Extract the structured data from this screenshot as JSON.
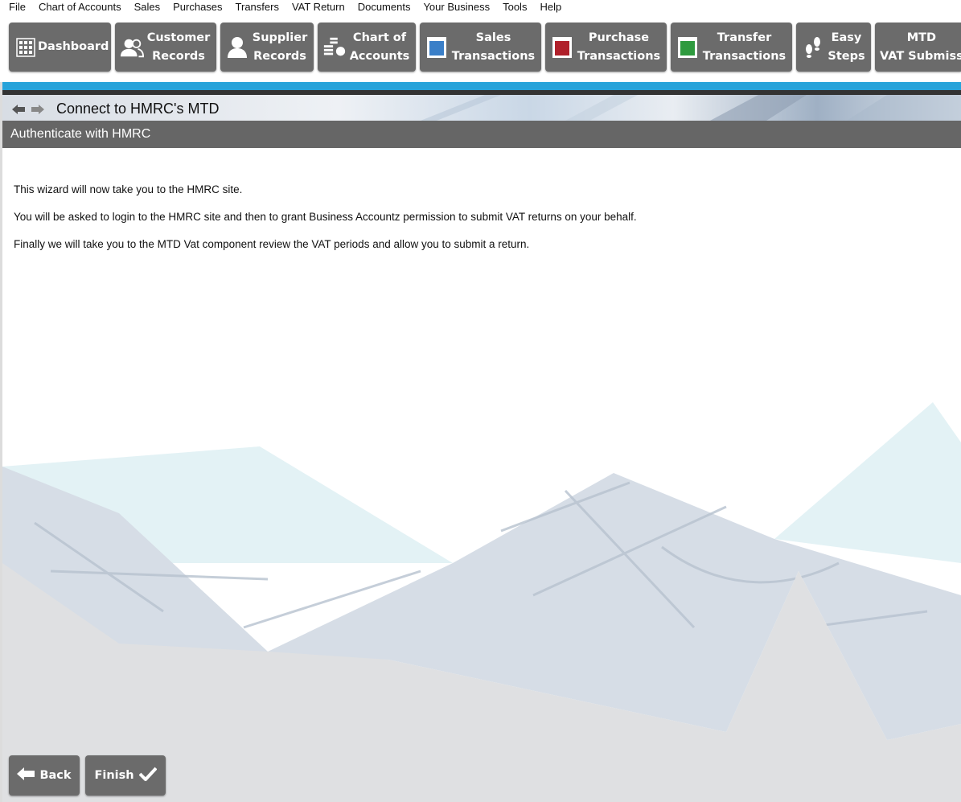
{
  "menu": [
    "File",
    "Chart of Accounts",
    "Sales",
    "Purchases",
    "Transfers",
    "VAT Return",
    "Documents",
    "Your Business",
    "Tools",
    "Help"
  ],
  "toolbar": {
    "dashboard": {
      "label": "Dashboard",
      "icon": "grid-icon"
    },
    "customer": {
      "line1": "Customer",
      "line2": "Records",
      "icon": "customers-icon"
    },
    "supplier": {
      "line1": "Supplier",
      "line2": "Records",
      "icon": "supplier-icon"
    },
    "chart": {
      "line1": "Chart of",
      "line2": "Accounts",
      "icon": "coins-icon"
    },
    "sales": {
      "line1": "Sales",
      "line2": "Transactions",
      "icon": "book-blue-icon",
      "color": "#3a7fc8"
    },
    "purchase": {
      "line1": "Purchase",
      "line2": "Transactions",
      "icon": "book-red-icon",
      "color": "#b0202a"
    },
    "transfer": {
      "line1": "Transfer",
      "line2": "Transactions",
      "icon": "book-green-icon",
      "color": "#2e9a3e"
    },
    "easy": {
      "line1": "Easy",
      "line2": "Steps",
      "icon": "footsteps-icon"
    },
    "mtd": {
      "line1": "MTD",
      "line2": "VAT Submiss",
      "icon": ""
    }
  },
  "breadcrumb": {
    "title": "Connect to HMRC's MTD"
  },
  "section": {
    "header": "Authenticate with HMRC"
  },
  "body": {
    "p1": "This wizard will now take you to the HMRC site.",
    "p2": "You will be asked to login to the HMRC site and then to grant Business Accountz permission to submit VAT returns on your behalf.",
    "p3": "Finally we will take you to the MTD Vat component review the VAT periods and allow you to submit a return."
  },
  "buttons": {
    "back": "Back",
    "finish": "Finish"
  },
  "colors": {
    "accent": "#27a3da",
    "button": "#6b6b6b",
    "header": "#666666"
  }
}
